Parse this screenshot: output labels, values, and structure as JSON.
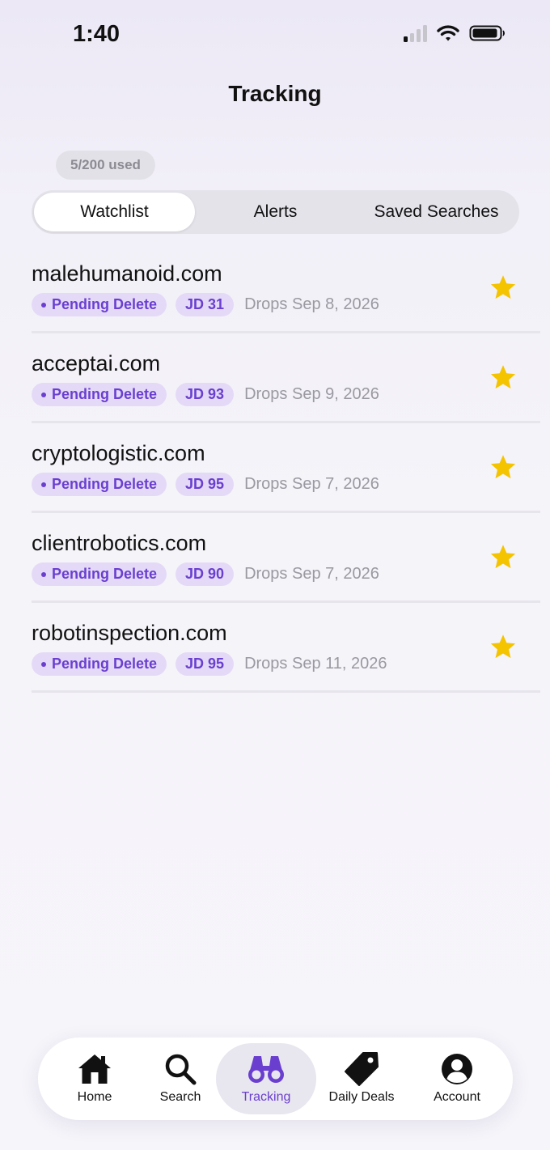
{
  "status_bar": {
    "time": "1:40",
    "icons": [
      "signal-icon",
      "wifi-icon",
      "battery-icon"
    ]
  },
  "header": {
    "title": "Tracking"
  },
  "usage": {
    "label": "5/200 used"
  },
  "segments": [
    {
      "label": "Watchlist",
      "active": true
    },
    {
      "label": "Alerts",
      "active": false
    },
    {
      "label": "Saved Searches",
      "active": false
    }
  ],
  "watchlist": [
    {
      "domain": "malehumanoid.com",
      "status": "Pending Delete",
      "jd": "JD 31",
      "drops": "Drops Sep 8, 2026",
      "starred": true
    },
    {
      "domain": "acceptai.com",
      "status": "Pending Delete",
      "jd": "JD 93",
      "drops": "Drops Sep 9, 2026",
      "starred": true
    },
    {
      "domain": "cryptologistic.com",
      "status": "Pending Delete",
      "jd": "JD 95",
      "drops": "Drops Sep 7, 2026",
      "starred": true
    },
    {
      "domain": "clientrobotics.com",
      "status": "Pending Delete",
      "jd": "JD 90",
      "drops": "Drops Sep 7, 2026",
      "starred": true
    },
    {
      "domain": "robotinspection.com",
      "status": "Pending Delete",
      "jd": "JD 95",
      "drops": "Drops Sep 11, 2026",
      "starred": true
    }
  ],
  "tabbar": [
    {
      "label": "Home",
      "icon": "home-icon",
      "active": false
    },
    {
      "label": "Search",
      "icon": "search-icon",
      "active": false
    },
    {
      "label": "Tracking",
      "icon": "binoculars-icon",
      "active": true
    },
    {
      "label": "Daily Deals",
      "icon": "tag-icon",
      "active": false
    },
    {
      "label": "Account",
      "icon": "account-icon",
      "active": false
    }
  ],
  "colors": {
    "accent": "#6a3fd0",
    "badge_bg": "#e4daf7",
    "star": "#f5c400",
    "muted_text": "#9a98a0"
  }
}
